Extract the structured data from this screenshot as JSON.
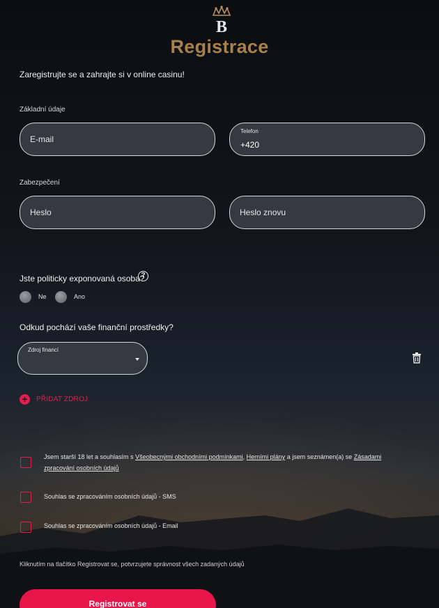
{
  "header": {
    "logo_letter": "B",
    "title": "Registrace"
  },
  "intro": "Zaregistrujte se a zahrajte si v online casinu!",
  "basic": {
    "label": "Základní údaje",
    "email_placeholder": "E-mail",
    "phone_label": "Telefon",
    "phone_value": "+420"
  },
  "security": {
    "label": "Zabezpečení",
    "password_placeholder": "Heslo",
    "password_repeat_placeholder": "Heslo znovu"
  },
  "pep": {
    "question": "Jste politicky exponovaná osoba?",
    "help": "?",
    "option_no": "Ne",
    "option_yes": "Ano"
  },
  "funds": {
    "question": "Odkud pochází vaše finanční prostředky?",
    "select_label": "Zdroj financí",
    "add_label": "PŘIDAT ZDROJ",
    "add_icon": "+"
  },
  "consents": {
    "terms_prefix": "Jsem starší 18 let a souhlasím s ",
    "terms_link": "Všeobecnými obchodními podmínkami",
    "terms_sep": ", ",
    "game_plans_link": "Herními plány",
    "terms_mid": " a jsem seznámen(a) se ",
    "privacy_link_1": "Zásadami",
    "privacy_link_2": "zpracování osobních údajů",
    "sms": "Souhlas se zpracováním osobních údajů - SMS",
    "email": "Souhlas se zpracováním osobních údajů - Email"
  },
  "confirm_text": "Kliknutím na tlačítko Registrovat se, potvrzujete správnost všech zadaných údajů",
  "submit_label": "Registrovat se",
  "colors": {
    "accent": "#e8154a",
    "gold": "#a9804b",
    "field_bg": "#343a41"
  },
  "icons": [
    "crown-logo-icon",
    "help-circle-icon",
    "trash-icon",
    "plus-circle-icon",
    "caret-down-icon"
  ]
}
